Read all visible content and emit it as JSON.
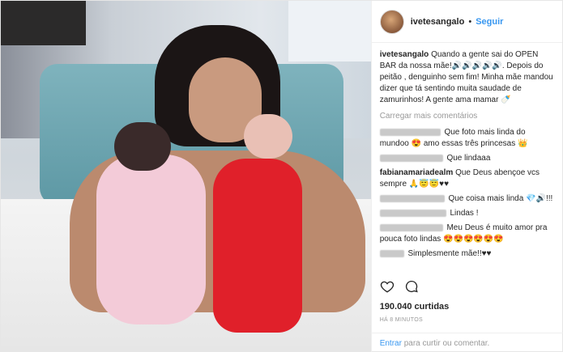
{
  "header": {
    "username": "ivetesangalo",
    "separator": "•",
    "follow_label": "Seguir"
  },
  "caption": {
    "username": "ivetesangalo",
    "text": "Quando a gente sai do OPEN BAR da nossa mãe!🔊🔊🔊🔊🔊. Depois do peitão , denguinho sem fim! Minha mãe mandou dizer que tá sentindo muita saudade de zamurinhos! A gente ama mamar 🍼"
  },
  "load_more_label": "Carregar mais comentários",
  "comments": [
    {
      "user": "",
      "text": "Que foto mais linda do mundoo 😍 amo essas três princesas 👑"
    },
    {
      "user": "",
      "text": "Que lindaaa"
    },
    {
      "user": "fabianamariadealm",
      "text": "Que Deus abençoe vcs sempre 🙏😇😇♥♥"
    },
    {
      "user": "",
      "text": "Que coisa mais linda 💎🔊!!!"
    },
    {
      "user": "",
      "text": "Lindas !"
    },
    {
      "user": "",
      "text": "Meu Deus é muito amor pra pouca foto lindas 😍😍😍😍😍😍"
    },
    {
      "user": "",
      "text": "Simplesmente mãe!!♥♥"
    }
  ],
  "likes_label": "190.040 curtidas",
  "timestamp": "HÁ 8 MINUTOS",
  "footer": {
    "login_link": "Entrar",
    "prompt": " para curtir ou comentar."
  },
  "icons": [
    "heart-icon",
    "comment-icon"
  ]
}
